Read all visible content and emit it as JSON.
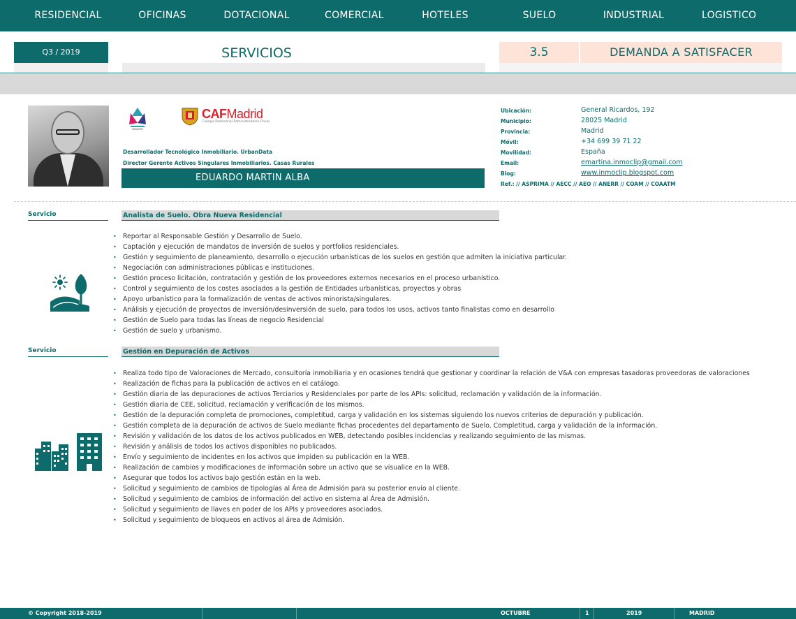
{
  "nav": [
    "RESIDENCIAL",
    "OFICINAS",
    "DOTACIONAL",
    "COMERCIAL",
    "HOTELES",
    "SUELO",
    "INDUSTRIAL",
    "LOGISTICO"
  ],
  "header": {
    "period": "Q3 / 2019",
    "title": "SERVICIOS",
    "number": "3.5",
    "demand": "DEMANDA A SATISFACER"
  },
  "profile": {
    "role1": "Desarrollador Tecnológico Inmobiliario. UrbanData",
    "role2": "Director Gerente Activos Singulares Inmobiliarios. Casas Rurales",
    "name": "EDUARDO MARTIN ALBA",
    "caf_logo": {
      "brand": "CAF",
      "city": "Madrid",
      "subtitle": "Colegio Profesional Administradores Fincas"
    }
  },
  "contact": [
    {
      "label": "Ubicación:",
      "value": "General Ricardos, 192"
    },
    {
      "label": "Municipio:",
      "value": "28025 Madrid"
    },
    {
      "label": "Provincia:",
      "value": "Madrid"
    },
    {
      "label": "Móvil:",
      "value": "+34 699 39 71 22"
    },
    {
      "label": "Movilidad:",
      "value": "España"
    },
    {
      "label": "Email:",
      "value": "emartina.inmoclip@gmail.com"
    },
    {
      "label": "Blog:",
      "value": "www.inmoclip.blogspot.com"
    }
  ],
  "refs": "Ref.: // ASPRIMA // AECC // AEO // ANERR // COAM // COAATM",
  "services": [
    {
      "label": "Servicio",
      "title": "Analista de Suelo. Obra Nueva Residencial",
      "icon": "land-tree-icon",
      "items": [
        "Reportar al Responsable Gestión y Desarrollo de Suelo.",
        "Captación y ejecución de mandatos de inversión de suelos y portfolios residenciales.",
        "Gestión y seguimiento de planeamiento, desarrollo o ejecución urbanísticas de los suelos en gestión que admiten la iniciativa particular.",
        "Negociación con administraciones públicas e instituciones.",
        "Gestión proceso licitación, contratación y gestión de los proveedores externos necesarios en el proceso urbanístico.",
        "Control y seguimiento de los costes asociados a la gestión de Entidades urbanísticas, proyectos y obras",
        "Apoyo urbanístico para la formalización de ventas de activos minorista/singulares.",
        "Análisis y ejecución de proyectos de inversión/desinversión de suelo, para todos los usos, activos tanto finalistas como en desarrollo",
        "Gestión de Suelo para todas las líneas de negocio Residencial",
        "Gestión de suelo y urbanismo."
      ]
    },
    {
      "label": "Servicio",
      "title": "Gestión en Depuración de Activos",
      "icon": "city-buildings-icon",
      "items": [
        "Realiza todo tipo de Valoraciones de Mercado, consultoría inmobiliaria y en ocasiones tendrá que gestionar y coordinar la relación de V&A con empresas tasadoras proveedoras de valoraciones",
        "Realización de fichas para la publicación de activos en el catálogo.",
        "Gestión diaria de las depuraciones de activos Terciarios y Residenciales por parte de los APIs: solicitud, reclamación y validación de la información.",
        "Gestión diaria de CEE, solicitud, reclamación y verificación de los mismos.",
        "Gestión de la depuración completa de promociones, completitud, carga y validación en los sistemas siguiendo los nuevos criterios de depuración y publicación.",
        "Gestión completa de la depuración de activos de Suelo mediante fichas procedentes del departamento de Suelo. Completitud, carga y validación de la información.",
        "Revisión y validación de los datos de los activos publicados en WEB, detectando posibles incidencias y realizando seguimiento de las mismas.",
        "Revisión y análisis de todos los activos disponibles no publicados.",
        "Envío y seguimiento de incidentes en los activos que impiden su publicación en la WEB.",
        "Realización de cambios y modificaciones de información sobre un activo que se visualice en la WEB.",
        "Asegurar que todos los activos bajo gestión están en la web.",
        "Solicitud y seguimiento de cambios de tipologías al Área de Admisión para su posterior envío al cliente.",
        "Solicitud y seguimiento de cambios de información del activo en sistema al Área de Admisión.",
        "Solicitud y seguimiento de llaves en poder de los APIs y proveedores asociados.",
        "Solicitud y seguimiento de bloqueos en activos al área de Admisión."
      ]
    }
  ],
  "footer": {
    "copyright": "© Copyright 2018-2019",
    "month": "OCTUBRE",
    "page": "1",
    "year": "2019",
    "city": "MADRID"
  },
  "colors": {
    "primary": "#0e6b6b",
    "accent_bg": "#fde3d8",
    "band": "#d9d9d9",
    "brand_red": "#d81e2a"
  }
}
